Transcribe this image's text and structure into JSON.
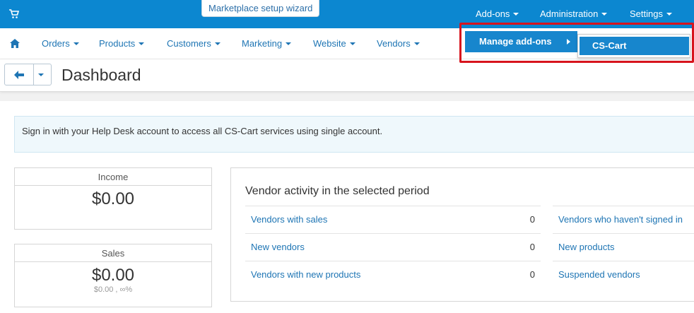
{
  "topbar": {
    "wizard_label": "Marketplace setup wizard",
    "menus": [
      "Add-ons",
      "Administration",
      "Settings"
    ]
  },
  "nav": {
    "items": [
      "Orders",
      "Products",
      "Customers",
      "Marketing",
      "Website",
      "Vendors"
    ]
  },
  "title": "Dashboard",
  "notice": "Sign in with your Help Desk account to access all CS-Cart services using single account.",
  "income": {
    "label": "Income",
    "value": "$0.00"
  },
  "sales": {
    "label": "Sales",
    "value": "$0.00",
    "sub": "$0.00 , ∞%"
  },
  "activity": {
    "title": "Vendor activity in the selected period",
    "left": [
      {
        "label": "Vendors with sales",
        "value": "0"
      },
      {
        "label": "New vendors",
        "value": "0"
      },
      {
        "label": "Vendors with new products",
        "value": "0"
      }
    ],
    "right": [
      {
        "label": "Vendors who haven't signed in"
      },
      {
        "label": "New products"
      },
      {
        "label": "Suspended vendors"
      }
    ]
  },
  "dropdown": {
    "manage_label": "Manage add-ons",
    "submenu_item": "CS-Cart"
  },
  "colors": {
    "accent": "#0c87d0",
    "link": "#1e75b4",
    "highlight": "#d7141d"
  }
}
